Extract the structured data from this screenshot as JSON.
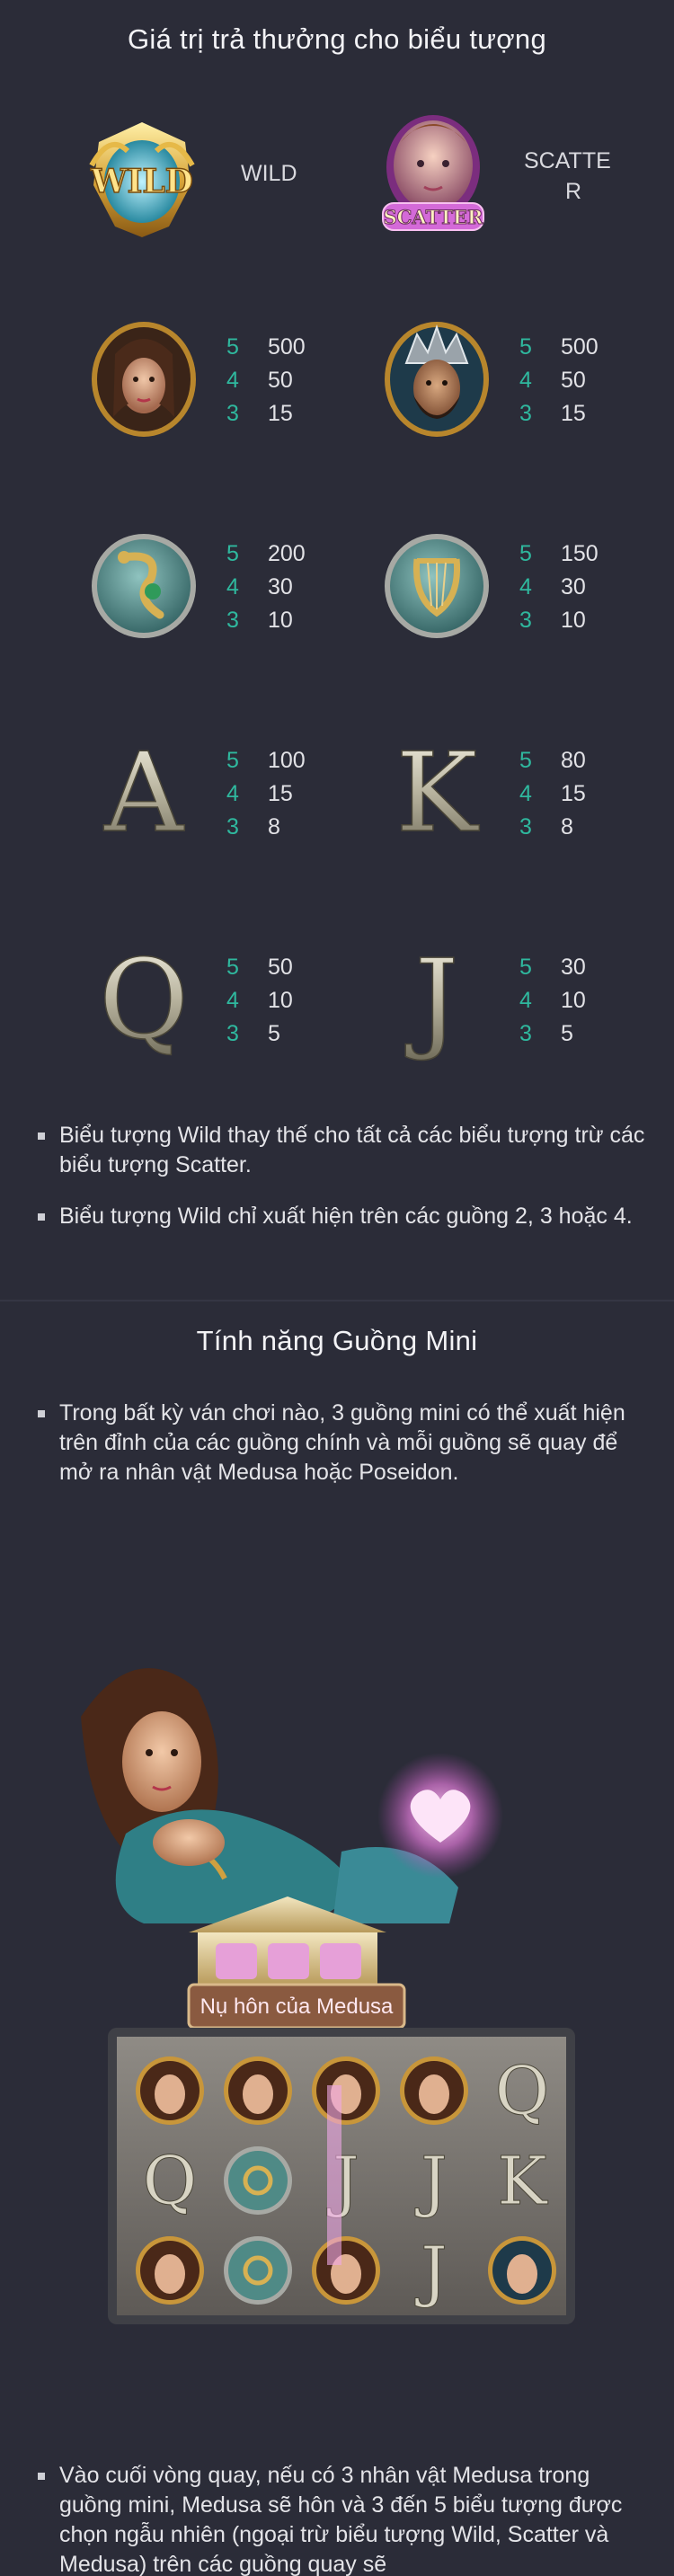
{
  "paytable": {
    "title": "Giá trị trả thưởng cho biểu tượng",
    "wild": {
      "badge": "WILD",
      "label": "WILD"
    },
    "scatter": {
      "badge": "SCATTER",
      "label_line1": "SCATTE",
      "label_line2": "R"
    },
    "symbols": [
      {
        "name": "medusa",
        "rows": [
          [
            "5",
            "500"
          ],
          [
            "4",
            "50"
          ],
          [
            "3",
            "15"
          ]
        ]
      },
      {
        "name": "poseidon",
        "rows": [
          [
            "5",
            "500"
          ],
          [
            "4",
            "50"
          ],
          [
            "3",
            "15"
          ]
        ]
      },
      {
        "name": "snake-coin",
        "rows": [
          [
            "5",
            "200"
          ],
          [
            "4",
            "30"
          ],
          [
            "3",
            "10"
          ]
        ]
      },
      {
        "name": "lyre-coin",
        "rows": [
          [
            "5",
            "150"
          ],
          [
            "4",
            "30"
          ],
          [
            "3",
            "10"
          ]
        ]
      },
      {
        "name": "A",
        "glyph": "A",
        "rows": [
          [
            "5",
            "100"
          ],
          [
            "4",
            "15"
          ],
          [
            "3",
            "8"
          ]
        ]
      },
      {
        "name": "K",
        "glyph": "K",
        "rows": [
          [
            "5",
            "80"
          ],
          [
            "4",
            "15"
          ],
          [
            "3",
            "8"
          ]
        ]
      },
      {
        "name": "Q",
        "glyph": "Q",
        "rows": [
          [
            "5",
            "50"
          ],
          [
            "4",
            "10"
          ],
          [
            "3",
            "5"
          ]
        ]
      },
      {
        "name": "J",
        "glyph": "J",
        "rows": [
          [
            "5",
            "30"
          ],
          [
            "4",
            "10"
          ],
          [
            "3",
            "5"
          ]
        ]
      }
    ],
    "bullets": [
      "Biểu tượng Wild thay thế cho tất cả các biểu tượng trừ các biểu tượng Scatter.",
      "Biểu tượng Wild chỉ xuất hiện trên các guồng 2, 3 hoặc 4."
    ]
  },
  "mini_reel": {
    "title": "Tính năng Guồng Mini",
    "bullet": "Trong bất kỳ ván chơi nào, 3 guồng mini có thể xuất hiện trên đỉnh của các guồng chính và mỗi guồng sẽ quay để mở ra nhân vật Medusa hoặc Poseidon.",
    "scene_banner": "Nụ hôn của Medusa",
    "grid": [
      [
        "M",
        "M",
        "M",
        "M",
        "Q"
      ],
      [
        "Q",
        "S",
        "J",
        "J",
        "K"
      ],
      [
        "M",
        "L",
        "M",
        "J",
        "P"
      ]
    ],
    "bottom_bullet": "Vào cuối vòng quay, nếu có 3 nhân vật Medusa trong guồng mini, Medusa sẽ hôn và 3 đến 5 biểu tượng được chọn ngẫu nhiên (ngoại trừ biểu tượng Wild, Scatter và Medusa) trên các guồng quay sẽ"
  },
  "colors": {
    "background": "#2b2c38",
    "accent": "#2fb89e",
    "gold": "#c9a24a"
  }
}
